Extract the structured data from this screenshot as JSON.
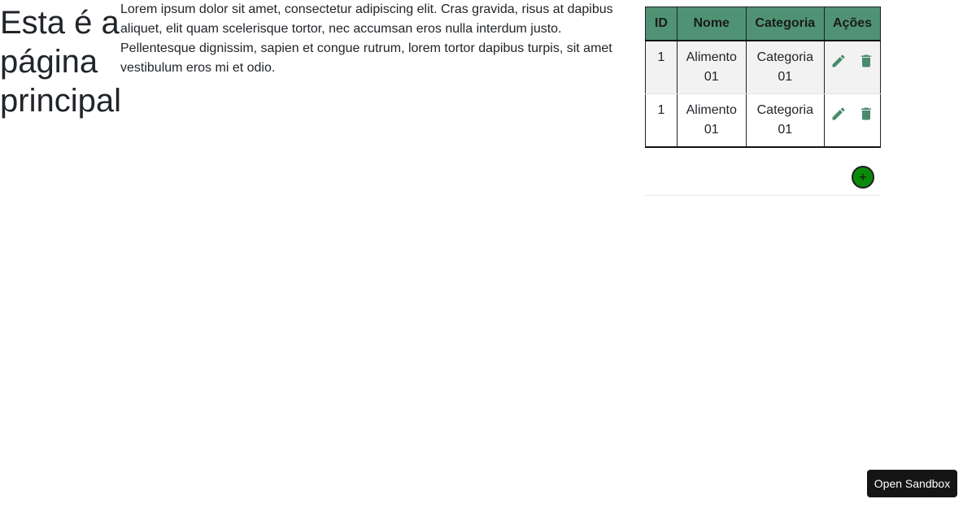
{
  "main": {
    "heading": "Esta é a página principal",
    "intro": "Lorem ipsum dolor sit amet, consectetur adipiscing elit. Cras gravida, risus at dapibus aliquet, elit quam scelerisque tortor, nec accumsan eros nulla interdum justo. Pellentesque dignissim, sapien et congue rutrum, lorem tortor dapibus turpis, sit amet vestibulum eros mi et odio."
  },
  "table": {
    "headers": {
      "id": "ID",
      "nome": "Nome",
      "categoria": "Categoria",
      "acoes": "Ações"
    },
    "rows": [
      {
        "id": "1",
        "nome": "Alimento 01",
        "categoria": "Categoria 01"
      },
      {
        "id": "1",
        "nome": "Alimento 01",
        "categoria": "Categoria 01"
      }
    ],
    "row_actions": [
      "pencil-icon",
      "trash-icon"
    ],
    "add_button_label": "+"
  },
  "sandbox": {
    "button_label": "Open Sandbox"
  },
  "colors": {
    "header_bg": "#4f9374",
    "icon": "#4a8a6c",
    "add_button": "#0b8a0b",
    "sandbox_bg": "#151515"
  }
}
